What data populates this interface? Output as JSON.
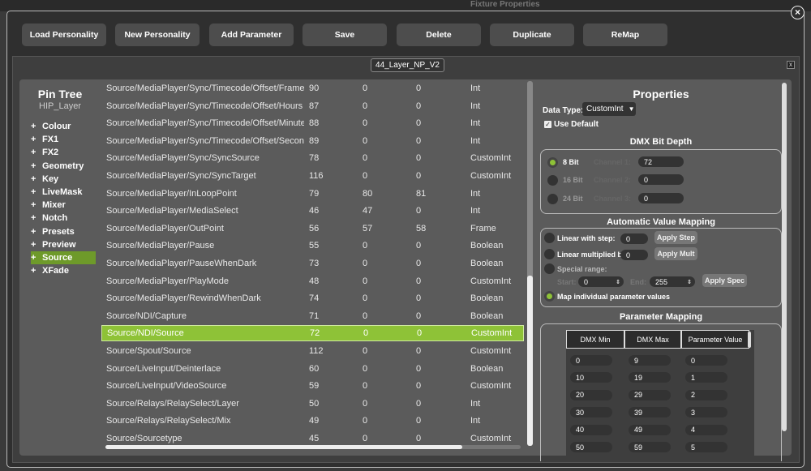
{
  "background": {
    "ghost_text": "Fixture Properties"
  },
  "close_icon": "×",
  "toolbar": [
    "Load Personality",
    "New Personality",
    "Add Parameter",
    "Save",
    "Delete",
    "Duplicate",
    "ReMap"
  ],
  "window": {
    "title": "44_Layer_NP_V2",
    "close": "x"
  },
  "pin_tree": {
    "title": "Pin Tree",
    "subtitle": "HIP_Layer",
    "items": [
      {
        "label": "Colour"
      },
      {
        "label": "FX1"
      },
      {
        "label": "FX2"
      },
      {
        "label": "Geometry"
      },
      {
        "label": "Key"
      },
      {
        "label": "LiveMask"
      },
      {
        "label": "Mixer"
      },
      {
        "label": "Notch"
      },
      {
        "label": "Presets"
      },
      {
        "label": "Preview"
      },
      {
        "label": "Source",
        "selected": true
      },
      {
        "label": "XFade"
      }
    ]
  },
  "params": [
    [
      "Source/MediaPlayer/Sync/Timecode/Offset/Frames",
      "90",
      "0",
      "0",
      "Int"
    ],
    [
      "Source/MediaPlayer/Sync/Timecode/Offset/Hours",
      "87",
      "0",
      "0",
      "Int"
    ],
    [
      "Source/MediaPlayer/Sync/Timecode/Offset/Minutes",
      "88",
      "0",
      "0",
      "Int"
    ],
    [
      "Source/MediaPlayer/Sync/Timecode/Offset/Seconds",
      "89",
      "0",
      "0",
      "Int"
    ],
    [
      "Source/MediaPlayer/Sync/SyncSource",
      "78",
      "0",
      "0",
      "CustomInt"
    ],
    [
      "Source/MediaPlayer/Sync/SyncTarget",
      "116",
      "0",
      "0",
      "CustomInt"
    ],
    [
      "Source/MediaPlayer/InLoopPoint",
      "79",
      "80",
      "81",
      "Int"
    ],
    [
      "Source/MediaPlayer/MediaSelect",
      "46",
      "47",
      "0",
      "Int"
    ],
    [
      "Source/MediaPlayer/OutPoint",
      "56",
      "57",
      "58",
      "Frame"
    ],
    [
      "Source/MediaPlayer/Pause",
      "55",
      "0",
      "0",
      "Boolean"
    ],
    [
      "Source/MediaPlayer/PauseWhenDark",
      "73",
      "0",
      "0",
      "Boolean"
    ],
    [
      "Source/MediaPlayer/PlayMode",
      "48",
      "0",
      "0",
      "CustomInt"
    ],
    [
      "Source/MediaPlayer/RewindWhenDark",
      "74",
      "0",
      "0",
      "Boolean"
    ],
    [
      "Source/NDI/Capture",
      "71",
      "0",
      "0",
      "Boolean"
    ],
    [
      "Source/NDI/Source",
      "72",
      "0",
      "0",
      "CustomInt"
    ],
    [
      "Source/Spout/Source",
      "112",
      "0",
      "0",
      "CustomInt"
    ],
    [
      "Source/LiveInput/Deinterlace",
      "60",
      "0",
      "0",
      "Boolean"
    ],
    [
      "Source/LiveInput/VideoSource",
      "59",
      "0",
      "0",
      "CustomInt"
    ],
    [
      "Source/Relays/RelaySelect/Layer",
      "50",
      "0",
      "0",
      "Int"
    ],
    [
      "Source/Relays/RelaySelect/Mix",
      "49",
      "0",
      "0",
      "Int"
    ],
    [
      "Source/Sourcetype",
      "45",
      "0",
      "0",
      "CustomInt"
    ]
  ],
  "selected_param": "Source/NDI/Source",
  "properties": {
    "title": "Properties",
    "data_type_label": "Data Type:",
    "data_type_value": "CustomInt",
    "use_default_label": "Use Default",
    "use_default_checked": true,
    "dmx_bit_depth": {
      "title": "DMX Bit Depth",
      "options": [
        {
          "label": "8 Bit",
          "channel_label": "Channel 1:",
          "value": "72",
          "selected": true
        },
        {
          "label": "16 Bit",
          "channel_label": "Channel 2:",
          "value": "0",
          "selected": false
        },
        {
          "label": "24 Bit",
          "channel_label": "Channel 3:",
          "value": "0",
          "selected": false
        }
      ]
    },
    "auto_mapping": {
      "title": "Automatic Value Mapping",
      "linear_step_label": "Linear with step:",
      "linear_step_value": "0",
      "apply_step": "Apply Step",
      "linear_mult_label": "Linear multiplied by:",
      "linear_mult_value": "0",
      "apply_mult": "Apply Mult",
      "special_range_label": "Special range:",
      "start_label": "Start:",
      "start_value": "0",
      "end_label": "End:",
      "end_value": "255",
      "apply_spec": "Apply Spec",
      "map_individual_label": "Map individual parameter values"
    },
    "parameter_mapping": {
      "title": "Parameter Mapping",
      "headers": [
        "DMX Min",
        "DMX Max",
        "Parameter Value"
      ],
      "rows": [
        [
          "0",
          "9",
          "0"
        ],
        [
          "10",
          "19",
          "1"
        ],
        [
          "20",
          "29",
          "2"
        ],
        [
          "30",
          "39",
          "3"
        ],
        [
          "40",
          "49",
          "4"
        ],
        [
          "50",
          "59",
          "5"
        ]
      ]
    }
  },
  "colors": {
    "accent": "#8ec237",
    "selected_tree": "#6e9a2a",
    "panel": "#5b5b5b"
  }
}
